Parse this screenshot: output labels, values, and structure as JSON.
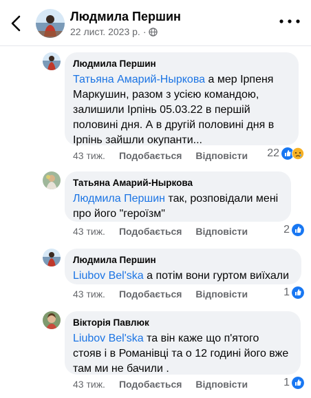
{
  "post": {
    "author": "Людмила Першин",
    "date": "22 лист. 2023 р.",
    "separator": "·"
  },
  "comments": [
    {
      "author": "Людмила Першин",
      "mention": "Татьяна Амарий-Ныркова",
      "text_line1": " а мер Ірпеня",
      "text_rest": [
        "Маркушин, разом з усією командою,",
        "залишили Ірпінь 05.03.22 в першій",
        "половині дня. А в другій половині дня в",
        "Ірпінь зайшли окупанти..."
      ],
      "time": "43 тиж.",
      "like_label": "Подобається",
      "reply_label": "Відповісти",
      "reaction_count": "22",
      "reactions": [
        "like-icon",
        "sad-icon"
      ]
    },
    {
      "author": "Татьяна Амарий-Ныркова",
      "mention": "Людмила Першин",
      "text_line1": " так, розповідали мені",
      "text_rest": [
        "про його \"героїзм\""
      ],
      "time": "43 тиж.",
      "like_label": "Подобається",
      "reply_label": "Відповісти",
      "reaction_count": "2",
      "reactions": [
        "like-icon"
      ]
    },
    {
      "author": "Людмила Першин",
      "mention": "Liubov Bel'ska",
      "text_line1": " а потім вони гуртом виїхали",
      "text_rest": [],
      "time": "43 тиж.",
      "like_label": "Подобається",
      "reply_label": "Відповісти",
      "reaction_count": "1",
      "reactions": [
        "like-icon"
      ]
    },
    {
      "author": "Вікторія Павлюк",
      "mention": "Liubov Bel'ska",
      "text_line1": " та він каже що п'ятого",
      "text_rest": [
        "стояв і в Романівці та о 12 годині його вже",
        "там ми не бачили ."
      ],
      "time": "43 тиж.",
      "like_label": "Подобається",
      "reply_label": "Відповісти",
      "reaction_count": "1",
      "reactions": [
        "like-icon"
      ]
    }
  ],
  "colors": {
    "mention": "#1b74e4",
    "bubble": "#f0f2f5",
    "secondary_text": "#65676b",
    "like_blue": "#1877f2",
    "sad_yellow": "#f7b125"
  }
}
